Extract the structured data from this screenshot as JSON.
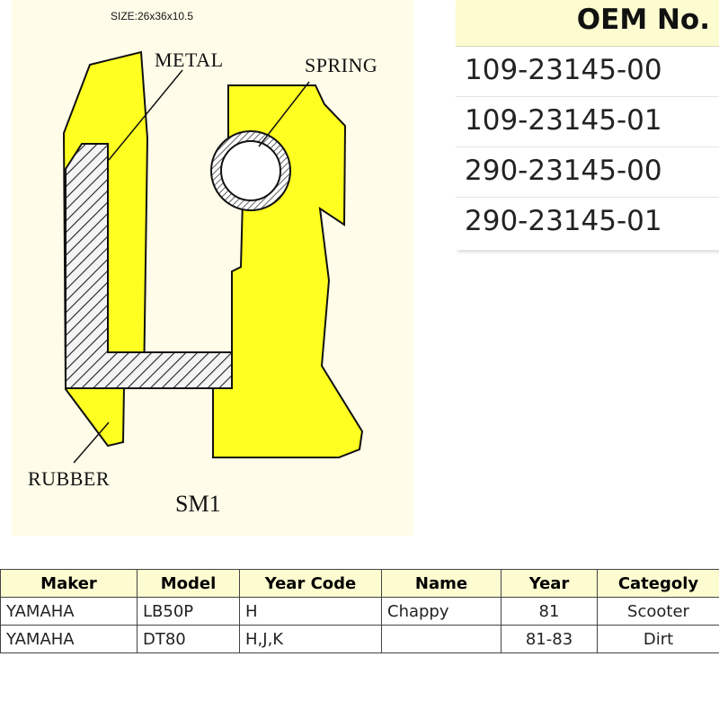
{
  "diagram": {
    "size_label": "SIZE:26x36x10.5",
    "labels": {
      "metal": "METAL",
      "spring": "SPRING",
      "rubber": "RUBBER",
      "model_code": "SM1"
    },
    "colors": {
      "rubber": "#ffff22",
      "background": "#fffde9",
      "outline": "#111111"
    }
  },
  "oem": {
    "header": "OEM No.",
    "numbers": [
      "109-23145-00",
      "109-23145-01",
      "290-23145-00",
      "290-23145-01"
    ]
  },
  "table": {
    "headers": [
      "Maker",
      "Model",
      "Year Code",
      "Name",
      "Year",
      "Categoly"
    ],
    "rows": [
      [
        "YAMAHA",
        "LB50P",
        "H",
        "Chappy",
        "81",
        "Scooter"
      ],
      [
        "YAMAHA",
        "DT80",
        "H,J,K",
        "",
        "81-83",
        "Dirt"
      ]
    ]
  }
}
